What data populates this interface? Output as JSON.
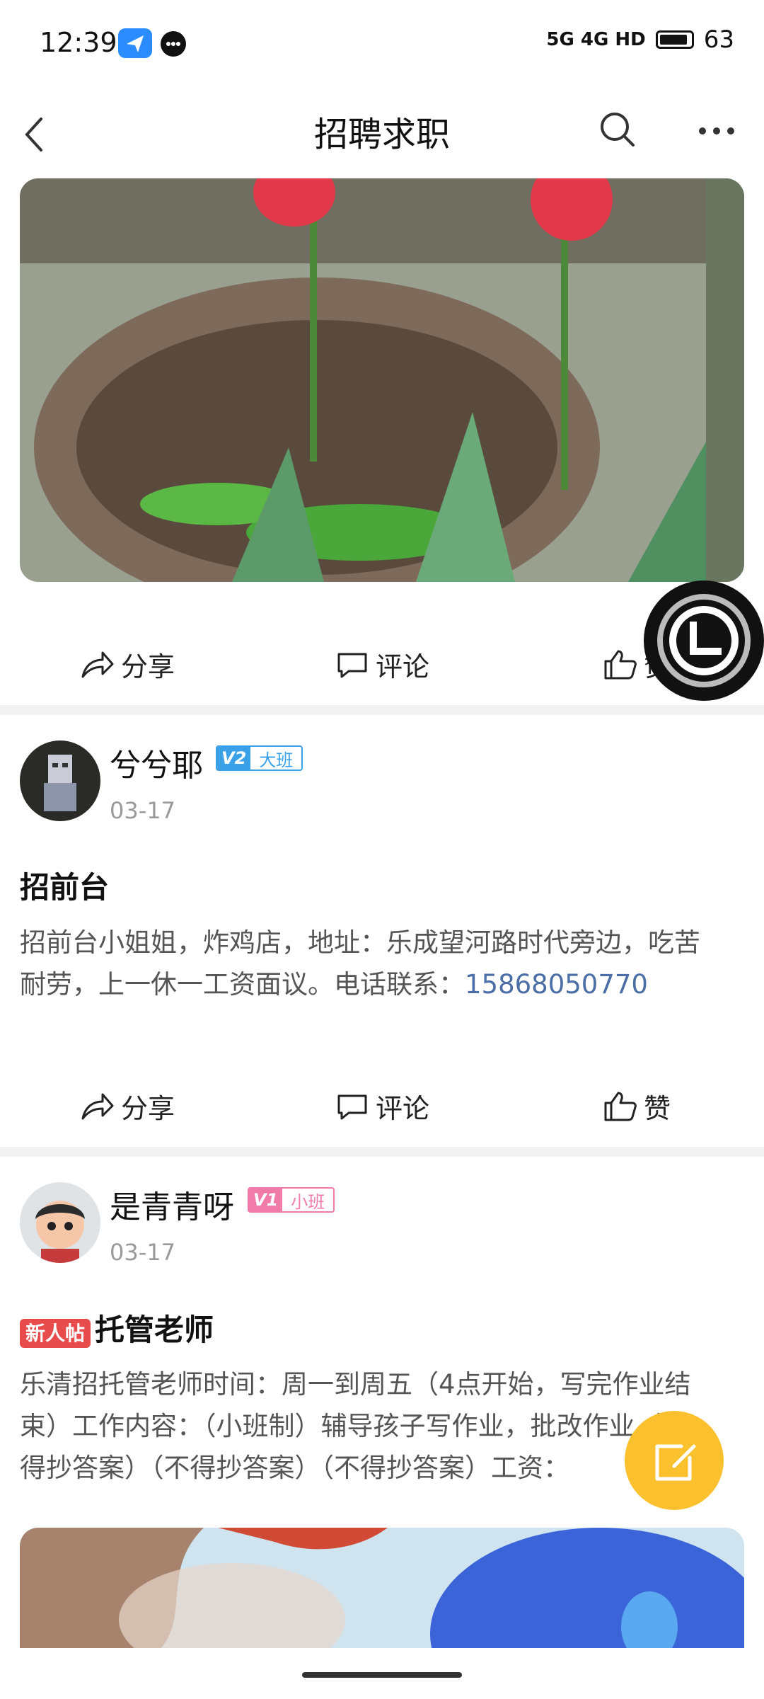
{
  "status_bar": {
    "time": "12:39",
    "network": "5G 4G HD",
    "battery": "63"
  },
  "nav": {
    "title": "招聘求职"
  },
  "actions": {
    "share": "分享",
    "comment": "评论",
    "like": "赞"
  },
  "posts": [
    {
      "username": "兮兮耶",
      "level": "V2",
      "level_name": "大班",
      "date": "03-17",
      "title": "招前台",
      "body_line1": "招前台小姐姐，炸鸡店，地址：乐成望河路时代旁边，吃苦",
      "body_line2_prefix": "耐劳，上一休一工资面议。电话联系：",
      "phone": "15868050770"
    },
    {
      "username": "是青青呀",
      "level": "V1",
      "level_name": "小班",
      "date": "03-17",
      "tag": "新人帖",
      "title": "托管老师",
      "body_line1": "乐清招托管老师时间：周一到周五（4点开始，写完作业结",
      "body_line2": "束）工作内容：（小班制）辅导孩子写作业，批改作业（不",
      "body_line3": "得抄答案）（不得抄答案）（不得抄答案）工资："
    }
  ],
  "colors": {
    "accent_yellow": "#fbc02d",
    "link_blue": "#4a6ea5",
    "badge_blue": "#3aa0e8",
    "badge_pink": "#f07aa8",
    "new_tag_red": "#e84b4b"
  }
}
